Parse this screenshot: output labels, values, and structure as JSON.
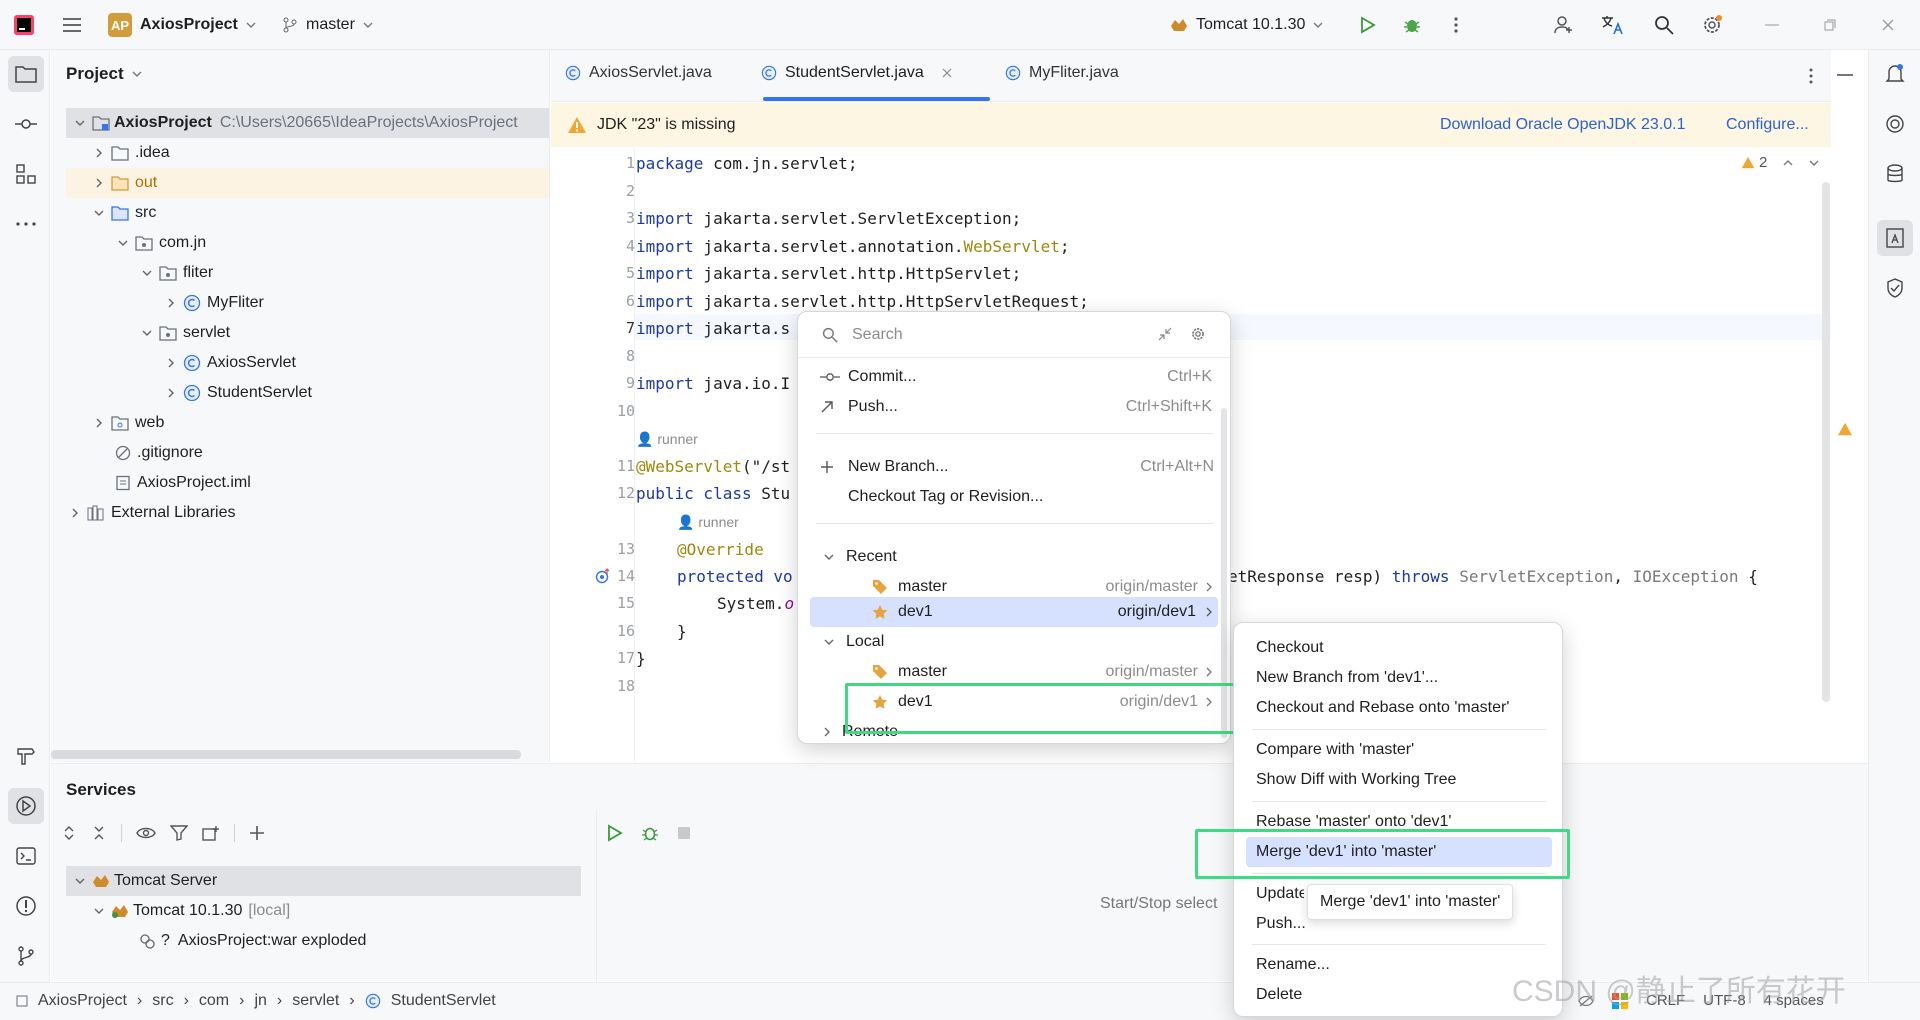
{
  "titlebar": {
    "project_badge": "AP",
    "project_name": "AxiosProject",
    "branch": "master",
    "run_config": "Tomcat 10.1.30"
  },
  "project_panel": {
    "title": "Project",
    "tree": [
      {
        "label": "AxiosProject",
        "path": "C:\\Users\\20665\\IdeaProjects\\AxiosProject"
      },
      {
        "label": ".idea"
      },
      {
        "label": "out"
      },
      {
        "label": "src"
      },
      {
        "label": "com.jn"
      },
      {
        "label": "fliter"
      },
      {
        "label": "MyFliter"
      },
      {
        "label": "servlet"
      },
      {
        "label": "AxiosServlet"
      },
      {
        "label": "StudentServlet"
      },
      {
        "label": "web"
      },
      {
        "label": ".gitignore"
      },
      {
        "label": "AxiosProject.iml"
      },
      {
        "label": "External Libraries"
      }
    ]
  },
  "editor": {
    "tabs": [
      {
        "label": "AxiosServlet.java"
      },
      {
        "label": "StudentServlet.java"
      },
      {
        "label": "MyFliter.java"
      }
    ],
    "banner": {
      "message": "JDK \"23\" is missing",
      "download_link": "Download Oracle OpenJDK 23.0.1",
      "configure_link": "Configure..."
    },
    "warning_count": "2",
    "line_numbers": [
      "1",
      "2",
      "3",
      "4",
      "5",
      "6",
      "7",
      "8",
      "9",
      "10",
      "11",
      "12",
      "13",
      "14",
      "15",
      "16",
      "17",
      "18"
    ],
    "code": {
      "l1a": "package",
      "l1b": " com.jn.servlet;",
      "l3a": "import",
      "l3b": " jakarta.servlet.ServletException;",
      "l4a": "import",
      "l4b": " jakarta.servlet.annotation.",
      "l4c": "WebServlet",
      "l4d": ";",
      "l5a": "import",
      "l5b": " jakarta.servlet.http.HttpServlet;",
      "l6a": "import",
      "l6b": " jakarta.servlet.http.HttpServletRequest;",
      "l7a": "import",
      "l7b": " jakarta.s",
      "l9a": "import",
      "l9b": " java.io.I",
      "inlay1": "runner",
      "l11a": "@WebServlet",
      "l11b": "(\"/st",
      "l12a": "public class",
      "l12b": " Stu",
      "inlay2": "runner",
      "l13a": "@Override",
      "l14a": "protected vo",
      "l14tail_a": "etResponse resp) ",
      "l14tail_b": "throws",
      "l14tail_c": " ServletException",
      "l14tail_d": ", ",
      "l14tail_e": "IOException",
      "l14tail_f": " {",
      "l15a": "System.",
      "l15b": "o",
      "l16a": "}",
      "l17a": "}"
    }
  },
  "services_panel": {
    "title": "Services",
    "tree": [
      {
        "label": "Tomcat Server"
      },
      {
        "label": "Tomcat 10.1.30",
        "suffix": "[local]"
      },
      {
        "label": "AxiosProject:war exploded",
        "prefix": "?"
      }
    ],
    "placeholder": "Start/Stop select"
  },
  "git_popup": {
    "search_placeholder": "Search",
    "actions": [
      {
        "label": "Commit...",
        "shortcut": "Ctrl+K"
      },
      {
        "label": "Push...",
        "shortcut": "Ctrl+Shift+K"
      },
      {
        "label": "New Branch...",
        "shortcut": "Ctrl+Alt+N"
      },
      {
        "label": "Checkout Tag or Revision..."
      }
    ],
    "recent_header": "Recent",
    "recent": [
      {
        "label": "master",
        "remote": "origin/master"
      },
      {
        "label": "dev1",
        "remote": "origin/dev1"
      }
    ],
    "local_header": "Local",
    "local": [
      {
        "label": "master",
        "remote": "origin/master"
      },
      {
        "label": "dev1",
        "remote": "origin/dev1"
      }
    ],
    "remote_header": "Remote"
  },
  "branch_submenu": {
    "items": [
      "Checkout",
      "New Branch from 'dev1'...",
      "Checkout and Rebase onto 'master'",
      "Compare with 'master'",
      "Show Diff with Working Tree",
      "Rebase 'master' onto 'dev1'",
      "Merge 'dev1' into 'master'",
      "Update",
      "Push...",
      "Rename...",
      "Delete"
    ],
    "tooltip": "Merge 'dev1' into 'master'"
  },
  "statusbar": {
    "breadcrumb": [
      "AxiosProject",
      "src",
      "com",
      "jn",
      "servlet",
      "StudentServlet"
    ],
    "line_ending": "CRLF",
    "encoding": "UTF-8",
    "indent": "4 spaces"
  },
  "watermark": "CSDN @静止了所有花开",
  "colors": {
    "highlight_box": "#3ddc84",
    "selection": "#d5e1ff",
    "accent": "#3574f0"
  }
}
